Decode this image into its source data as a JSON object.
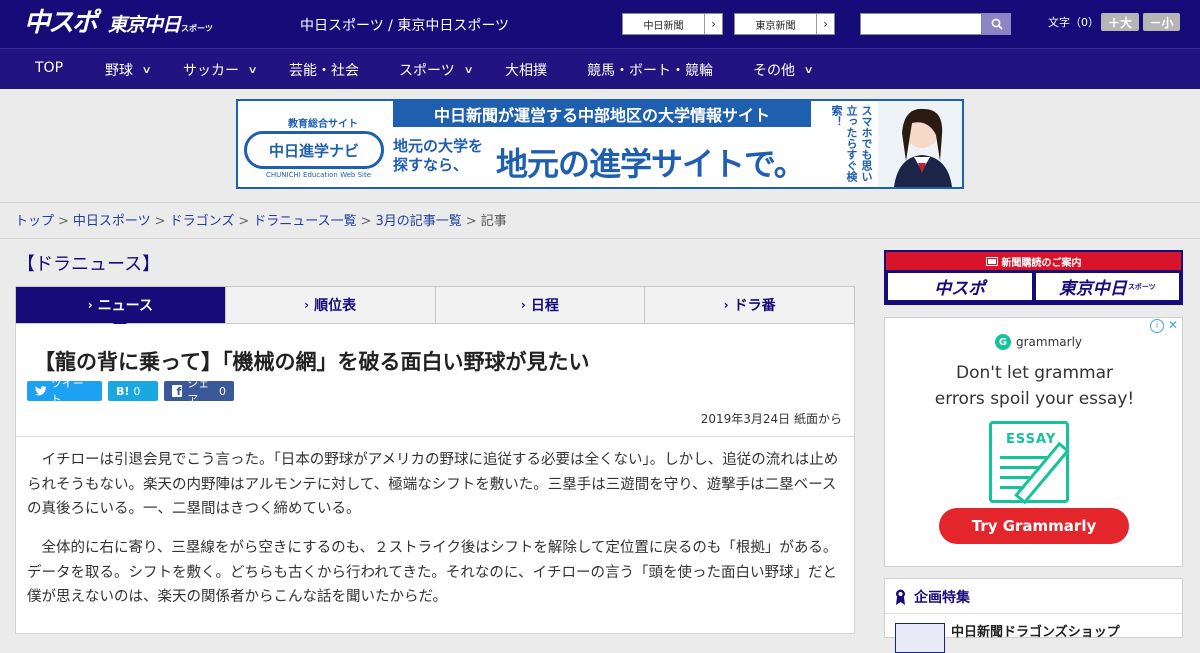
{
  "header": {
    "logo_main": "中スポ",
    "logo_tokyo": "東京中日",
    "logo_tokyo_small": "スポーツ",
    "site_title": "中日スポーツ / 東京中日スポーツ",
    "btn_chunichi": "中日新聞",
    "btn_tokyo": "東京新聞",
    "search_placeholder": "",
    "moji_label": "文字（0）",
    "moji_plus": "＋大",
    "moji_minus": "－小"
  },
  "nav": {
    "items": [
      {
        "label": "TOP",
        "has_dropdown": false
      },
      {
        "label": "野球",
        "has_dropdown": true
      },
      {
        "label": "サッカー",
        "has_dropdown": true
      },
      {
        "label": "芸能・社会",
        "has_dropdown": false
      },
      {
        "label": "スポーツ",
        "has_dropdown": true
      },
      {
        "label": "大相撲",
        "has_dropdown": false
      },
      {
        "label": "競馬・ボート・競輪",
        "has_dropdown": false
      },
      {
        "label": "その他",
        "has_dropdown": true
      }
    ]
  },
  "banner": {
    "edu_label": "教育総合サイト",
    "logo_text": "中日進学ナビ",
    "web_site": "CHUNICHI Education Web Site",
    "top_text": "中日新聞が運営する中部地区の大学情報サイト",
    "sub_text_1": "地元の大学を",
    "sub_text_2": "探すなら、",
    "big_text": "地元の進学サイトで。",
    "vertical_text": "スマホでも思い立ったらすぐ検索！"
  },
  "breadcrumb": {
    "items": [
      "トップ",
      "中日スポーツ",
      "ドラゴンズ",
      "ドラニュース一覧",
      "3月の記事一覧"
    ],
    "current": "記事",
    "separator": ">"
  },
  "section": {
    "title": "【ドラニュース】"
  },
  "tabs": [
    {
      "label": "ニュース",
      "active": true
    },
    {
      "label": "順位表",
      "active": false
    },
    {
      "label": "日程",
      "active": false
    },
    {
      "label": "ドラ番",
      "active": false
    }
  ],
  "article": {
    "title": "【龍の背に乗って】「機械の網」を破る面白い野球が見たい",
    "share_tweet": "ツイート",
    "share_hatena_icon": "B!",
    "share_hatena_count": "0",
    "share_fb_label": "シェア",
    "share_fb_count": "0",
    "date": "2019年3月24日 紙面から",
    "paragraphs": [
      "イチローは引退会見でこう言った。「日本の野球がアメリカの野球に追従する必要は全くない」。しかし、追従の流れは止められそうもない。楽天の内野陣はアルモンテに対して、極端なシフトを敷いた。三塁手は三遊間を守り、遊撃手は二塁ベースの真後ろにいる。一、二塁間はきつく締めている。",
      "全体的に右に寄り、三塁線をがら空きにするのも、２ストライク後はシフトを解除して定位置に戻るのも「根拠」がある。データを取る。シフトを敷く。どちらも古くから行われてきた。それなのに、イチローの言う「頭を使った面白い野球」だと僕が思えないのは、楽天の関係者からこんな話を聞いたからだ。"
    ]
  },
  "sidebar": {
    "subscribe_header": "新聞購読のご案内",
    "sub_logo_1": "中スポ",
    "sub_logo_2": "東京中日",
    "sub_logo_2_small": "スポーツ",
    "ad": {
      "brand": "grammarly",
      "headline_1": "Don't let grammar",
      "headline_2": "errors spoil your essay!",
      "doc_title": "ESSAY",
      "cta": "Try Grammarly",
      "info_icon": "ⓘ",
      "close_icon": "✕"
    },
    "feature_title": "企画特集",
    "feature_item": "中日新聞ドラゴンズショップ"
  },
  "colors": {
    "brand_navy": "#170b7a",
    "nav_navy": "#221380",
    "banner_blue": "#1f5fb0",
    "twitter": "#1da1f2",
    "hatena": "#19a8e0",
    "facebook": "#3b5998",
    "grammarly_green": "#15c39a",
    "grammarly_red": "#e2262c",
    "subscribe_red": "#d7142a"
  }
}
